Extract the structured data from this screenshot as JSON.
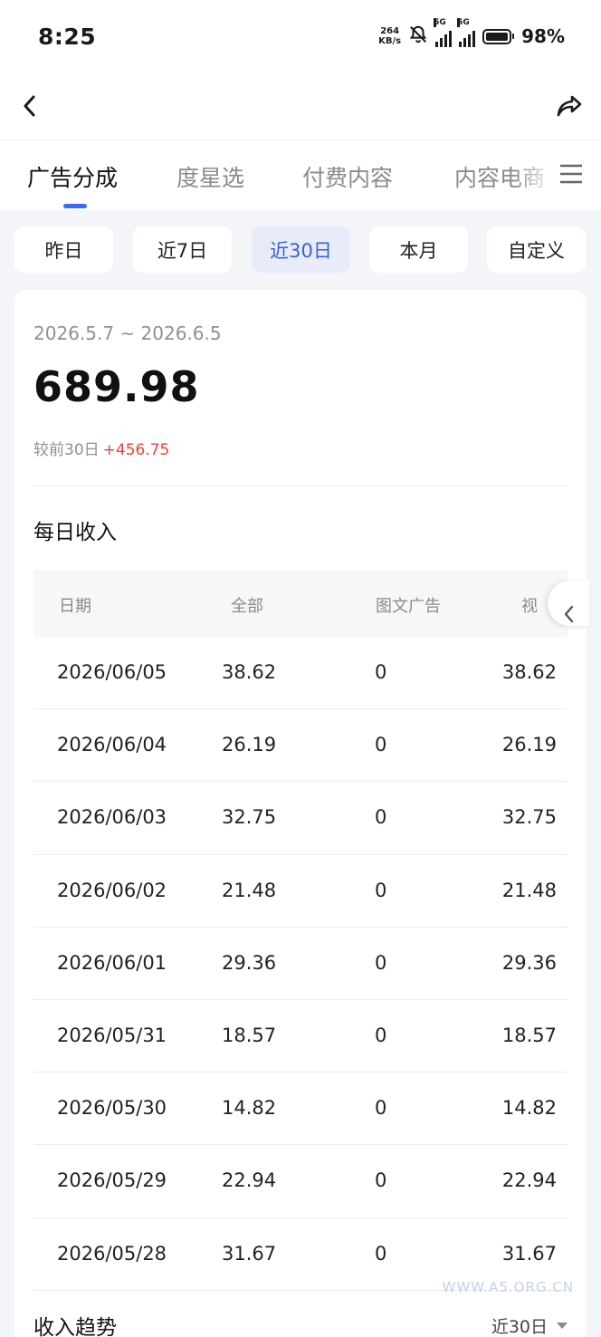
{
  "status_bar": {
    "time": "8:25",
    "speed_value": "264",
    "speed_unit": "KB/s",
    "signal1_label": "5G",
    "signal2_label": "5G",
    "battery": "98%"
  },
  "tabs": [
    {
      "label": "广告分成",
      "active": true
    },
    {
      "label": "度星选",
      "active": false
    },
    {
      "label": "付费内容",
      "active": false
    },
    {
      "label": "内容电商",
      "active": false
    }
  ],
  "date_chips": [
    {
      "label": "昨日",
      "active": false
    },
    {
      "label": "近7日",
      "active": false
    },
    {
      "label": "近30日",
      "active": true
    },
    {
      "label": "本月",
      "active": false
    },
    {
      "label": "自定义",
      "active": false
    }
  ],
  "summary": {
    "range": "2026.5.7 ~ 2026.6.5",
    "total": "689.98",
    "compare_label": "较前30日",
    "compare_value": "+456.75"
  },
  "daily": {
    "title": "每日收入",
    "columns": [
      "日期",
      "全部",
      "图文广告",
      "视频广告"
    ],
    "rows": [
      [
        "2026/06/05",
        "38.62",
        "0",
        "38.62"
      ],
      [
        "2026/06/04",
        "26.19",
        "0",
        "26.19"
      ],
      [
        "2026/06/03",
        "32.75",
        "0",
        "32.75"
      ],
      [
        "2026/06/02",
        "21.48",
        "0",
        "21.48"
      ],
      [
        "2026/06/01",
        "29.36",
        "0",
        "29.36"
      ],
      [
        "2026/05/31",
        "18.57",
        "0",
        "18.57"
      ],
      [
        "2026/05/30",
        "14.82",
        "0",
        "14.82"
      ],
      [
        "2026/05/29",
        "22.94",
        "0",
        "22.94"
      ],
      [
        "2026/05/28",
        "31.67",
        "0",
        "31.67"
      ]
    ]
  },
  "trend": {
    "title": "收入趋势",
    "selector": "近30日"
  },
  "watermark": "WWW.A5.ORG.CN",
  "colors": {
    "accent": "#3a6cf4",
    "active_chip_bg": "#e7ebfa",
    "active_chip_text": "#3a5fd8",
    "positive_delta": "#e8433a",
    "background": "#f4f5f9"
  }
}
